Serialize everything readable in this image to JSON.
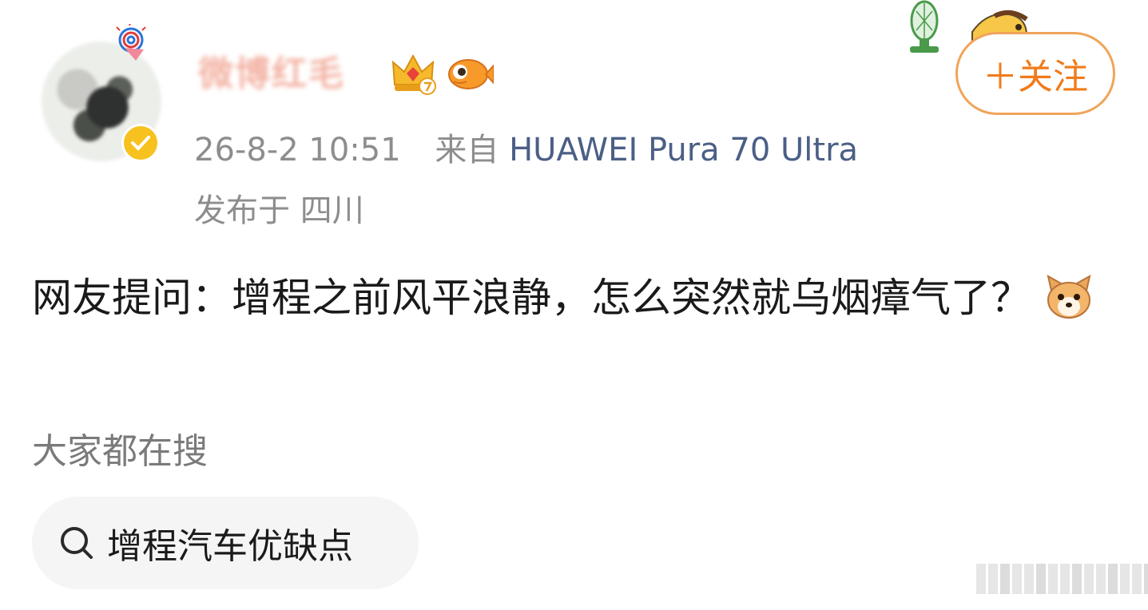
{
  "post": {
    "username": "微博红毛",
    "timestamp": "26-8-2 10:51",
    "source_prefix": "来自",
    "device": "HUAWEI Pura 70 Ultra",
    "location_prefix": "发布于",
    "location": "四川",
    "text": "网友提问：增程之前风平浪静，怎么突然就乌烟瘴气了？",
    "emoji": "dog-emoji"
  },
  "follow_button": {
    "label": "＋关注"
  },
  "search": {
    "heading": "大家都在搜",
    "query": "增程汽车优缺点"
  },
  "colors": {
    "accent_orange": "#f07b1a",
    "follow_border": "#f0a45a",
    "device_link": "#4b5f86",
    "meta_gray": "#8d8d8d",
    "chip_bg": "#f5f5f5"
  }
}
